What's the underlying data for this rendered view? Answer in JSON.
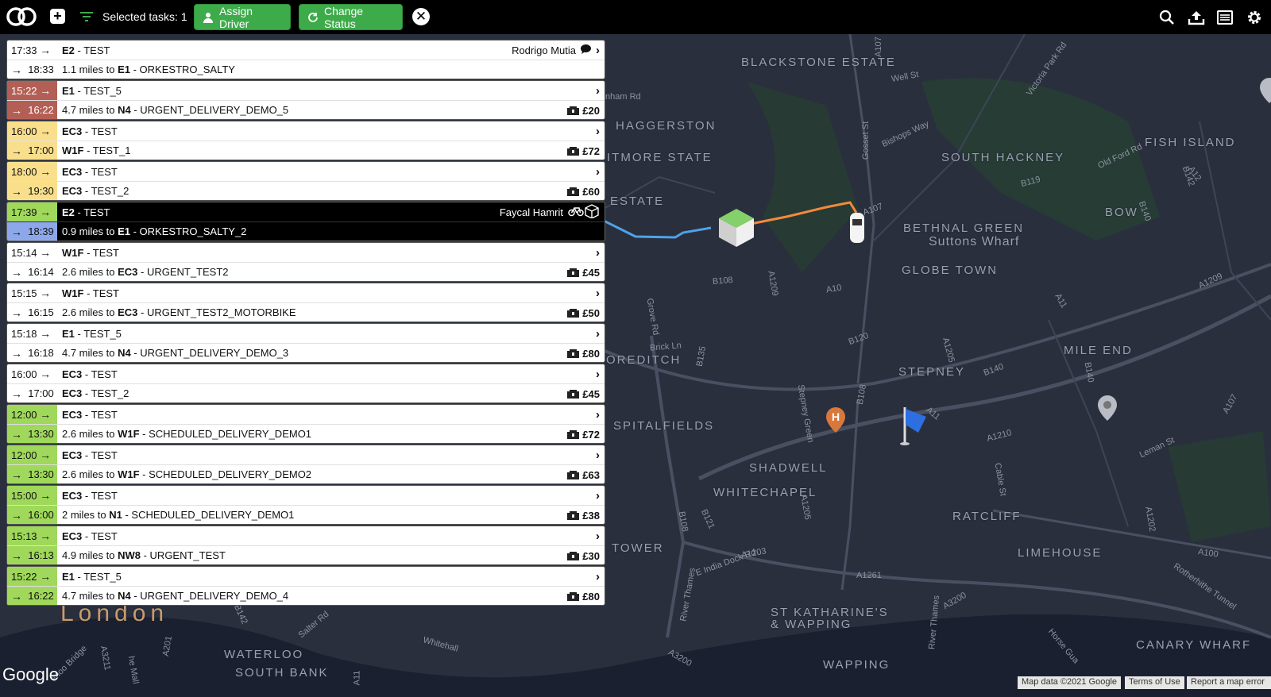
{
  "topbar": {
    "selected_label": "Selected tasks: 1",
    "assign_driver": "Assign Driver",
    "change_status": "Change Status"
  },
  "colors": {
    "accent_green": "#3eab4a",
    "late_red": "#b45f55",
    "warn_yellow": "#f9df8b",
    "ok_green": "#9fd85a",
    "active_blue": "#8da8ea"
  },
  "icons": [
    "logo-icon",
    "plus-icon",
    "filter-icon",
    "driver-icon",
    "refresh-icon",
    "close-icon",
    "search-icon",
    "upload-icon",
    "list-icon",
    "gear-icon",
    "chat-icon",
    "bike-icon",
    "parcel-icon",
    "chevron-right-icon"
  ],
  "tasks": [
    {
      "pickup_time": "17:33",
      "pickup_color": "",
      "pickup_code": "E2",
      "pickup_name": " - TEST",
      "driver": "Rodrigo Mutia",
      "driver_icon": "chat",
      "drop_time": "18:33",
      "drop_color": "",
      "distance": "1.1 miles to ",
      "drop_code": "E1",
      "drop_name": "  - ORKESTRO_SALTY",
      "price": "",
      "selected": false
    },
    {
      "pickup_time": "15:22",
      "pickup_color": "c-red",
      "pickup_code": "E1",
      "pickup_name": "  - TEST_5",
      "driver": "",
      "driver_icon": "",
      "drop_time": "16:22",
      "drop_color": "c-red",
      "distance": "4.7 miles to ",
      "drop_code": "N4",
      "drop_name": "  - URGENT_DELIVERY_DEMO_5",
      "price": "£20",
      "selected": false
    },
    {
      "pickup_time": "16:00",
      "pickup_color": "c-yellow",
      "pickup_code": "EC3",
      "pickup_name": " - TEST",
      "driver": "",
      "driver_icon": "",
      "drop_time": "17:00",
      "drop_color": "c-yellow",
      "distance": "",
      "drop_code": "W1F",
      "drop_name": " - TEST_1",
      "price": "£72",
      "selected": false
    },
    {
      "pickup_time": "18:00",
      "pickup_color": "c-yellow",
      "pickup_code": "EC3",
      "pickup_name": " - TEST",
      "driver": "",
      "driver_icon": "",
      "drop_time": "19:30",
      "drop_color": "c-yellow",
      "distance": "",
      "drop_code": "EC3",
      "drop_name": " - TEST_2",
      "price": "£60",
      "selected": false
    },
    {
      "pickup_time": "17:39",
      "pickup_color": "c-green",
      "pickup_code": "E2",
      "pickup_name": "  - TEST",
      "driver": "Faycal Hamrit",
      "driver_icon": "bike",
      "drop_time": "18:39",
      "drop_color": "c-blue",
      "distance": "0.9 miles to ",
      "drop_code": "E1",
      "drop_name": "  - ORKESTRO_SALTY_2",
      "price": "",
      "selected": true
    },
    {
      "pickup_time": "15:14",
      "pickup_color": "",
      "pickup_code": "W1F",
      "pickup_name": " - TEST",
      "driver": "",
      "driver_icon": "",
      "drop_time": "16:14",
      "drop_color": "",
      "distance": "2.6 miles to ",
      "drop_code": "EC3",
      "drop_name": " - URGENT_TEST2",
      "price": "£45",
      "selected": false
    },
    {
      "pickup_time": "15:15",
      "pickup_color": "",
      "pickup_code": "W1F",
      "pickup_name": " - TEST",
      "driver": "",
      "driver_icon": "",
      "drop_time": "16:15",
      "drop_color": "",
      "distance": "2.6 miles to ",
      "drop_code": "EC3",
      "drop_name": " - URGENT_TEST2_MOTORBIKE",
      "price": "£50",
      "selected": false
    },
    {
      "pickup_time": "15:18",
      "pickup_color": "",
      "pickup_code": "E1",
      "pickup_name": "  - TEST_5",
      "driver": "",
      "driver_icon": "",
      "drop_time": "16:18",
      "drop_color": "",
      "distance": "4.7 miles to ",
      "drop_code": "N4",
      "drop_name": "  - URGENT_DELIVERY_DEMO_3",
      "price": "£80",
      "selected": false
    },
    {
      "pickup_time": "16:00",
      "pickup_color": "",
      "pickup_code": "EC3",
      "pickup_name": " - TEST",
      "driver": "",
      "driver_icon": "",
      "drop_time": "17:00",
      "drop_color": "",
      "distance": "",
      "drop_code": "EC3",
      "drop_name": " - TEST_2",
      "price": "£45",
      "selected": false
    },
    {
      "pickup_time": "12:00",
      "pickup_color": "c-green",
      "pickup_code": "EC3",
      "pickup_name": " - TEST",
      "driver": "",
      "driver_icon": "",
      "drop_time": "13:30",
      "drop_color": "c-green",
      "distance": "2.6 miles to ",
      "drop_code": "W1F",
      "drop_name": " - SCHEDULED_DELIVERY_DEMO1",
      "price": "£72",
      "selected": false
    },
    {
      "pickup_time": "12:00",
      "pickup_color": "c-green",
      "pickup_code": "EC3",
      "pickup_name": " - TEST",
      "driver": "",
      "driver_icon": "",
      "drop_time": "13:30",
      "drop_color": "c-green",
      "distance": "2.6 miles to ",
      "drop_code": "W1F",
      "drop_name": " - SCHEDULED_DELIVERY_DEMO2",
      "price": "£63",
      "selected": false
    },
    {
      "pickup_time": "15:00",
      "pickup_color": "c-green",
      "pickup_code": "EC3",
      "pickup_name": " - TEST",
      "driver": "",
      "driver_icon": "",
      "drop_time": "16:00",
      "drop_color": "c-green",
      "distance": "2 miles to ",
      "drop_code": "N1",
      "drop_name": "  - SCHEDULED_DELIVERY_DEMO1",
      "price": "£38",
      "selected": false
    },
    {
      "pickup_time": "15:13",
      "pickup_color": "c-green",
      "pickup_code": "EC3",
      "pickup_name": " - TEST",
      "driver": "",
      "driver_icon": "",
      "drop_time": "16:13",
      "drop_color": "c-green",
      "distance": "4.9 miles to ",
      "drop_code": "NW8",
      "drop_name": " - URGENT_TEST",
      "price": "£30",
      "selected": false
    },
    {
      "pickup_time": "15:22",
      "pickup_color": "c-green",
      "pickup_code": "E1",
      "pickup_name": "  - TEST_5",
      "driver": "",
      "driver_icon": "",
      "drop_time": "16:22",
      "drop_color": "c-green",
      "distance": "4.7 miles to ",
      "drop_code": "N4",
      "drop_name": "  - URGENT_DELIVERY_DEMO_4",
      "price": "£80",
      "selected": false
    }
  ],
  "map": {
    "areas": [
      "BLACKSTONE ESTATE",
      "HAGGERSTON",
      "ITMORE STATE",
      "ESTATE",
      "SOUTH HACKNEY",
      "FISH ISLAND",
      "BOW",
      "BETHNAL GREEN",
      "Suttons Wharf",
      "GLOBE TOWN",
      "MILE END",
      "STEPNEY",
      "OREDITCH",
      "SPITALFIELDS",
      "SHADWELL",
      "WHITECHAPEL",
      "RATCLIFF",
      "TOWER",
      "LIMEHOUSE",
      "ST KATHARINE'S",
      "& WAPPING",
      "WAPPING",
      "CANARY WHARF",
      "WATERLOO",
      "SOUTH BANK"
    ],
    "city": "London",
    "roads": [
      "A107",
      "Well St",
      "Victoria Park Rd",
      "nham Rd",
      "Old Ford Rd",
      "B142",
      "A12",
      "Bishops Way",
      "B119",
      "A107",
      "Gosset St",
      "B108",
      "A1209",
      "A10",
      "Grove Rd",
      "A11",
      "A1209",
      "Brick Ln",
      "B135",
      "B120",
      "A1205",
      "B140",
      "A107",
      "B108",
      "Stepney Green",
      "A11",
      "B140",
      "A1210",
      "Leman St",
      "B108",
      "B121",
      "A1205",
      "Cable St",
      "A1202",
      "A1203",
      "E India Dock Rd",
      "A1261",
      "A100",
      "Rotherhithe Tunnel",
      "River Thames",
      "River Thames",
      "A3200",
      "A3200",
      "Salter Rd",
      "Whitehall",
      "Horse Gua",
      "he Mall",
      "A3211",
      "erloo Bridge",
      "A201",
      "B142",
      "A11",
      "B140"
    ],
    "google": "Google",
    "footer_data": "Map data ©2021 Google",
    "footer_terms": "Terms of Use",
    "footer_report": "Report a map error"
  }
}
